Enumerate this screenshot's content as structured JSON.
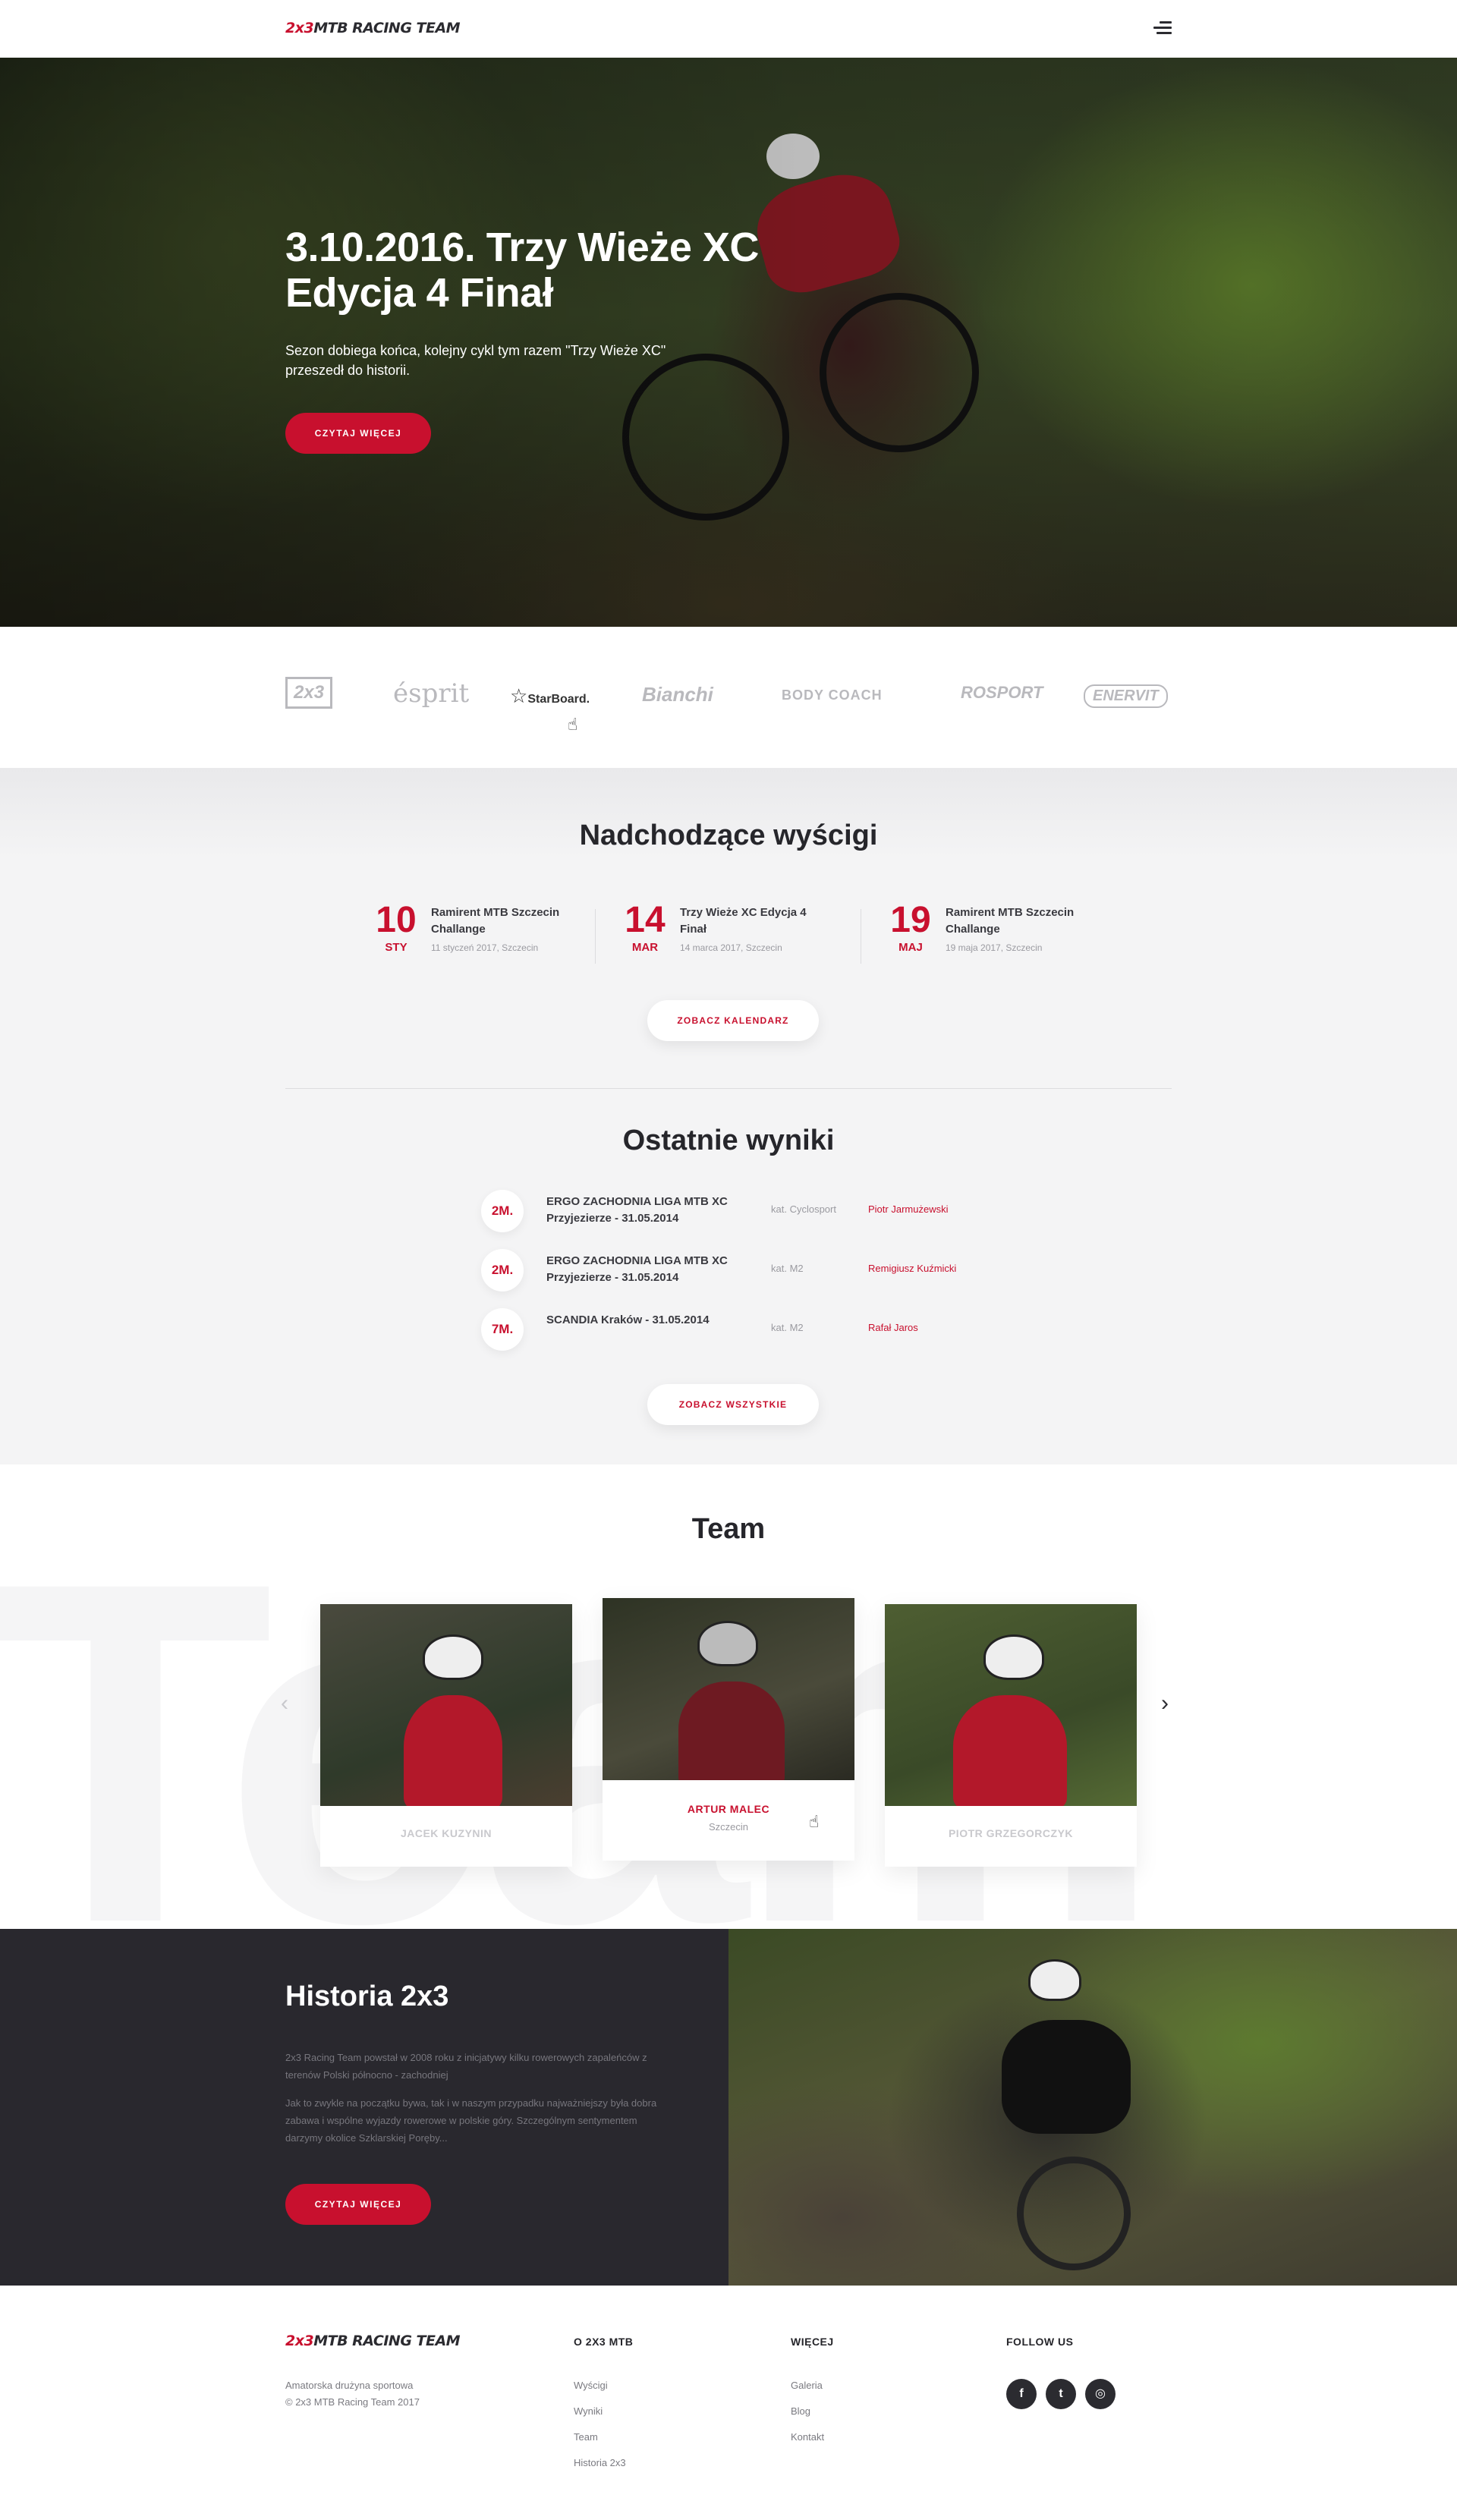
{
  "header": {
    "logo_prefix": "2x3",
    "logo_rest": "MTB RACING TEAM",
    "menu_icon": "hamburger-menu-icon"
  },
  "hero": {
    "title": "3.10.2016. Trzy Wieże XC Edycja 4 Finał",
    "text": "Sezon dobiega końca, kolejny cykl tym razem \"Trzy Wieże XC\" przeszedł do historii.",
    "button": "CZYTAJ WIĘCEJ"
  },
  "sponsors": [
    "2x3",
    "ésprit",
    "StarBoard.",
    "Bianchi",
    "BODY COACH",
    "ROSPORT",
    "ENERVIT"
  ],
  "upcoming": {
    "title": "Nadchodzące wyścigi",
    "races": [
      {
        "day": "10",
        "month": "STY",
        "name": "Ramirent MTB Szczecin Challange",
        "meta": "11 styczeń 2017, Szczecin"
      },
      {
        "day": "14",
        "month": "MAR",
        "name": "Trzy Wieże XC Edycja 4 Finał",
        "meta": "14 marca 2017, Szczecin"
      },
      {
        "day": "19",
        "month": "MAJ",
        "name": "Ramirent MTB Szczecin Challange",
        "meta": "19 maja 2017, Szczecin"
      }
    ],
    "button": "ZOBACZ KALENDARZ"
  },
  "results": {
    "title": "Ostatnie wyniki",
    "items": [
      {
        "place": "2M.",
        "event": "ERGO ZACHODNIA LIGA MTB XC Przyjezierze - 31.05.2014",
        "category": "kat. Cyclosport",
        "rider": "Piotr Jarmużewski"
      },
      {
        "place": "2M.",
        "event": "ERGO ZACHODNIA LIGA MTB XC Przyjezierze - 31.05.2014",
        "category": "kat. M2",
        "rider": "Remigiusz Kuźmicki"
      },
      {
        "place": "7M.",
        "event": "SCANDIA Kraków - 31.05.2014",
        "category": "kat. M2",
        "rider": "Rafał Jaros"
      }
    ],
    "button": "ZOBACZ WSZYSTKIE"
  },
  "team": {
    "title": "Team",
    "background_word": "Team",
    "members": [
      {
        "name": "JACEK KUZYNIN",
        "city": ""
      },
      {
        "name": "ARTUR MALEC",
        "city": "Szczecin"
      },
      {
        "name": "PIOTR GRZEGORCZYK",
        "city": ""
      }
    ]
  },
  "history": {
    "title": "Historia 2x3",
    "p1": "2x3 Racing Team powstał w 2008 roku z inicjatywy kilku rowerowych zapaleńców z terenów Polski północno - zachodniej",
    "p2": "Jak to zwykle na początku bywa, tak i w naszym przypadku najważniejszy była dobra zabawa i wspólne wyjazdy rowerowe w polskie góry. Szczególnym sentymentem darzymy okolice Szklarskiej Poręby...",
    "button": "CZYTAJ WIĘCEJ"
  },
  "footer": {
    "tagline": "Amatorska drużyna sportowa",
    "copyright": "© 2x3 MTB Racing Team 2017",
    "col1": {
      "title": "O 2X3 MTB",
      "links": [
        "Wyścigi",
        "Wyniki",
        "Team",
        "Historia 2x3"
      ]
    },
    "col2": {
      "title": "WIĘCEJ",
      "links": [
        "Galeria",
        "Blog",
        "Kontakt"
      ]
    },
    "col3": {
      "title": "FOLLOW US",
      "social": [
        "f",
        "t",
        "◎"
      ]
    }
  },
  "colors": {
    "accent": "#c8102e",
    "dark": "#29282e",
    "light_bg": "#f4f4f5"
  }
}
